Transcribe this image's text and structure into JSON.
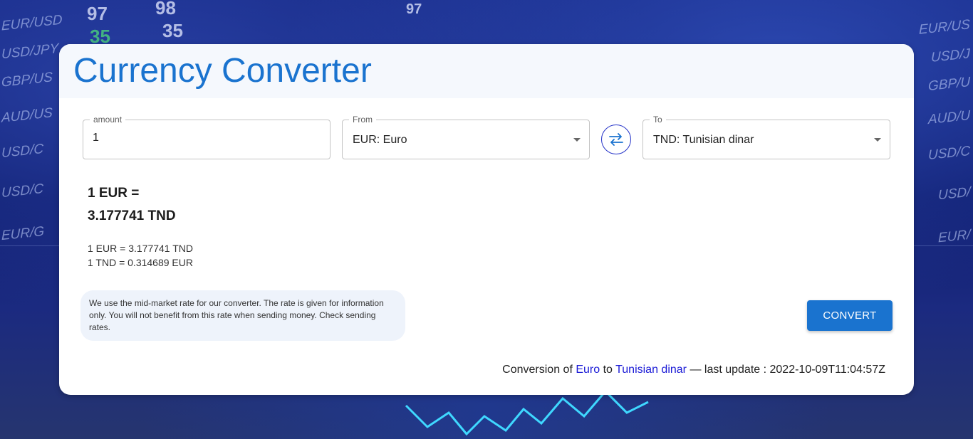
{
  "background": {
    "tickers_left": [
      "EUR/USD",
      "USD/JPY",
      "GBP/US",
      "AUD/US",
      "USD/C",
      "USD/C",
      "EUR/G"
    ],
    "tickers_right": [
      "EUR/US",
      "USD/J",
      "GBP/U",
      "AUD/U",
      "USD/C",
      "USD/",
      "EUR/"
    ],
    "numbers": [
      "97",
      "98",
      "35",
      "35",
      "97"
    ]
  },
  "header": {
    "title": "Currency Converter"
  },
  "form": {
    "amount_label": "amount",
    "amount_value": "1",
    "from_label": "From",
    "from_value": "EUR: Euro",
    "to_label": "To",
    "to_value": "TND: Tunisian dinar"
  },
  "result": {
    "main_line1": "1 EUR =",
    "main_line2": "3.177741 TND",
    "rate_forward": "1 EUR = 3.177741 TND",
    "rate_reverse": "1 TND = 0.314689 EUR"
  },
  "note": "We use the mid-market rate for our converter. The rate is given for information only. You will not benefit from this rate when sending money. Check sending rates.",
  "convert_label": "Convert",
  "footer": {
    "prefix": "Conversion of ",
    "from_link": "Euro",
    "middle": " to ",
    "to_link": "Tunisian dinar",
    "suffix": " — last update : 2022-10-09T11:04:57Z"
  },
  "colors": {
    "accent": "#1a73cf",
    "link": "#1a1ad6",
    "swap_border": "#2533c8"
  }
}
